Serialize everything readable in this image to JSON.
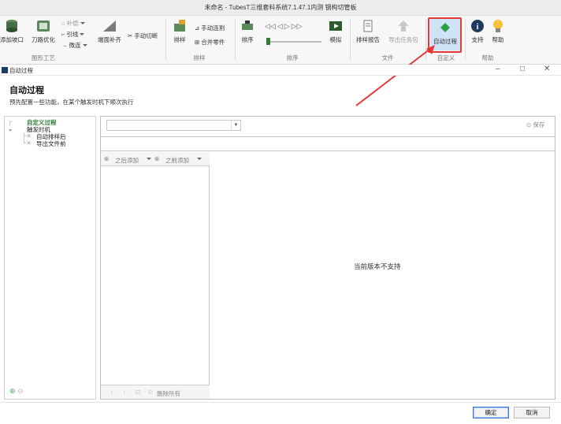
{
  "window": {
    "title": "未命名 - TubesT三维套料系统7.1.47.1内测  钢构切管板"
  },
  "ribbon": {
    "add_port": "添加坡口",
    "path_opt": "刀路优化",
    "fill": "补偿",
    "lead": "引线",
    "micro": "微连",
    "end_cut": "端面补齐",
    "manual_cut": "手动切断",
    "nest": "排样",
    "manual_connect": "手动连割",
    "merge_parts": "合并零件",
    "sort": "排序",
    "simulate": "模拟",
    "nest_report": "排样报告",
    "export_task": "导出任务包",
    "auto_process": "自动过程",
    "support": "支持",
    "help": "帮助",
    "groups": {
      "craft": "图形工艺",
      "nest": "排样",
      "sort": "排序",
      "file": "文件",
      "custom": "自定义",
      "help": "帮助"
    }
  },
  "subwindow": {
    "title": "自动过程",
    "minimize": "–",
    "maximize": "□",
    "close": "✕"
  },
  "page": {
    "heading": "自动过程",
    "description": "预先配置一些功能，在某个触发时机下顺次执行"
  },
  "tree": {
    "root": "自定义过程",
    "trigger": "触发时机",
    "after_nest": "自动排样后",
    "before_export": "导出文件前"
  },
  "editor": {
    "combo_value": "",
    "save": "保存",
    "add_after": "之后添加",
    "add_before": "之前添加",
    "delete_all": "删除所有",
    "unsupported": "当前版本不支持"
  },
  "footer": {
    "ok": "确定",
    "cancel": "取消"
  },
  "colors": {
    "highlight": "#e53935",
    "green": "#4caf50",
    "accent": "#3c78d8"
  }
}
